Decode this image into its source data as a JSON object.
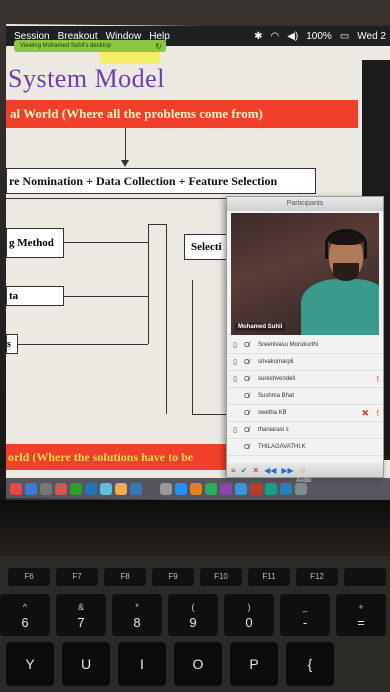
{
  "menubar": {
    "items": [
      "Session",
      "Breakout",
      "Window",
      "Help"
    ],
    "battery": "100%",
    "clock": "Wed 2"
  },
  "viewing_badge": "Viewing Mohamed Suhil's desktop",
  "slide": {
    "title": "System Model",
    "top_bar": "al World (Where all the problems come from)",
    "feature_box": "re Nomination + Data Collection + Feature Selection",
    "box_method": "g Method",
    "box_data": "ta",
    "box_small": "s",
    "box_select": "Selecti",
    "bottom_bar": "orld (Where the solutions have to be"
  },
  "panel": {
    "title": "Participants",
    "video_name": "Mohamed Suhil",
    "participants": [
      {
        "name": "Sreenivasu Morukurthi",
        "device": true,
        "x": false,
        "alert": false
      },
      {
        "name": "srivakumarpil",
        "device": true,
        "x": false,
        "alert": false
      },
      {
        "name": "sureshvendell",
        "device": true,
        "x": false,
        "alert": true
      },
      {
        "name": "Sushma Bhat",
        "device": false,
        "x": false,
        "alert": false
      },
      {
        "name": "swetha KB",
        "device": false,
        "x": true,
        "alert": true
      },
      {
        "name": "thaniarasi s",
        "device": true,
        "x": false,
        "alert": false
      },
      {
        "name": "THILAGAVATHI.K",
        "device": false,
        "x": false,
        "alert": false
      }
    ]
  },
  "dock": {
    "audio_label": "Audio",
    "colors": [
      "#e44",
      "#3a7bd5",
      "#777",
      "#d9534f",
      "#2ca02c",
      "#1f77b4",
      "#5bc0de",
      "#f0ad4e",
      "#337ab7",
      "#555",
      "#999",
      "#1e90ff",
      "#e67e22",
      "#27ae60",
      "#8e44ad",
      "#3498db",
      "#c0392b",
      "#16a085",
      "#2980b9",
      "#7f8c8d"
    ]
  },
  "keyboard": {
    "fkeys": [
      "F6",
      "F7",
      "F8",
      "F9",
      "F10",
      "F11",
      "F12",
      ""
    ],
    "numkeys": [
      {
        "top": "^",
        "bottom": "6"
      },
      {
        "top": "&",
        "bottom": "7"
      },
      {
        "top": "*",
        "bottom": "8"
      },
      {
        "top": "(",
        "bottom": "9"
      },
      {
        "top": ")",
        "bottom": "0"
      },
      {
        "top": "_",
        "bottom": "-"
      },
      {
        "top": "+",
        "bottom": "="
      }
    ],
    "letters": [
      "Y",
      "U",
      "I",
      "O",
      "P",
      "{"
    ]
  }
}
